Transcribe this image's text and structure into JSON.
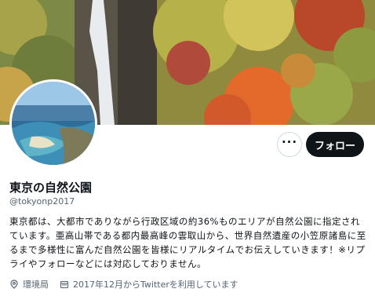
{
  "profile": {
    "display_name": "東京の自然公園",
    "handle": "@tokyonp2017",
    "bio": "東京都は、大都市でありながら行政区域の約36%ものエリアが自然公園に指定されています。亜高山帯である都内最高峰の雲取山から、世界自然遺産の小笠原諸島に至るまで多様性に富んだ自然公園を皆様にリアルタイムでお伝えしていきます！※リプライやフォローなどには対応しておりません。",
    "location": "環境局",
    "joined": "2017年12月からTwitterを利用しています"
  },
  "actions": {
    "more_label": "···",
    "follow_label": "フォロー"
  },
  "icons": {
    "more": "more-dots-icon",
    "location": "location-pin-icon",
    "calendar": "calendar-icon"
  },
  "colors": {
    "follow_bg": "#0f1419",
    "secondary_text": "#536471",
    "border": "#cfd9de"
  }
}
